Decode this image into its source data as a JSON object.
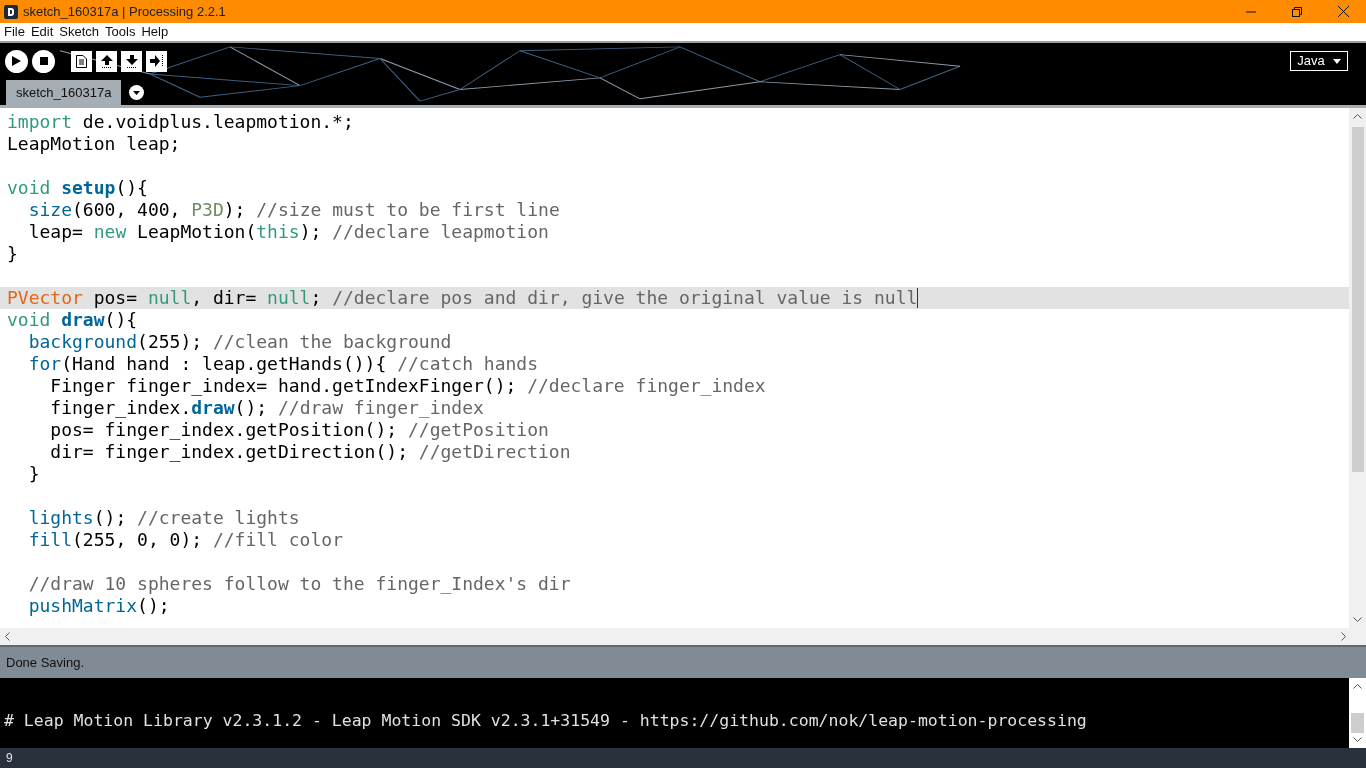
{
  "window": {
    "title": "sketch_160317a | Processing 2.2.1"
  },
  "menu": [
    "File",
    "Edit",
    "Sketch",
    "Tools",
    "Help"
  ],
  "toolbar": {
    "mode": "Java"
  },
  "tabs": [
    {
      "label": "sketch_160317a",
      "selected": true
    }
  ],
  "editor": {
    "lines": [
      {
        "selected": false,
        "tokens": [
          {
            "kind": "keyword",
            "text": "import"
          },
          {
            "kind": "plain",
            "text": " de.voidplus.leapmotion.*;"
          }
        ]
      },
      {
        "selected": false,
        "tokens": [
          {
            "kind": "plain",
            "text": "LeapMotion leap;"
          }
        ]
      },
      {
        "selected": false
      },
      {
        "selected": false,
        "tokens": [
          {
            "kind": "keyword",
            "text": "void "
          },
          {
            "kind": "method",
            "text": "setup"
          },
          {
            "kind": "plain",
            "text": "(){"
          }
        ]
      },
      {
        "selected": false,
        "tokens": [
          {
            "kind": "function",
            "text": "  size"
          },
          {
            "kind": "plain",
            "text": "(600, 400, "
          },
          {
            "kind": "constant",
            "text": "P3D"
          },
          {
            "kind": "plain",
            "text": "); "
          },
          {
            "kind": "comment",
            "text": "//size must to be first line"
          }
        ]
      },
      {
        "selected": false,
        "tokens": [
          {
            "kind": "plain",
            "text": "  leap= "
          },
          {
            "kind": "keyword",
            "text": "new"
          },
          {
            "kind": "plain",
            "text": " LeapMotion("
          },
          {
            "kind": "keyword",
            "text": "this"
          },
          {
            "kind": "plain",
            "text": "); "
          },
          {
            "kind": "comment",
            "text": "//declare leapmotion"
          }
        ]
      },
      {
        "selected": false,
        "tokens": [
          {
            "kind": "plain",
            "text": "}"
          }
        ]
      },
      {
        "selected": false
      },
      {
        "selected": true,
        "tokens": [
          {
            "kind": "type",
            "text": "PVector"
          },
          {
            "kind": "plain",
            "text": " pos= "
          },
          {
            "kind": "keyword",
            "text": "null"
          },
          {
            "kind": "plain",
            "text": ", dir= "
          },
          {
            "kind": "keyword",
            "text": "null"
          },
          {
            "kind": "plain",
            "text": "; "
          },
          {
            "kind": "comment",
            "text": "//declare pos and dir, give the original value is null"
          }
        ]
      },
      {
        "selected": false,
        "tokens": [
          {
            "kind": "keyword",
            "text": "void "
          },
          {
            "kind": "method",
            "text": "draw"
          },
          {
            "kind": "plain",
            "text": "(){"
          }
        ]
      },
      {
        "selected": false,
        "tokens": [
          {
            "kind": "function",
            "text": "  background"
          },
          {
            "kind": "plain",
            "text": "(255); "
          },
          {
            "kind": "comment",
            "text": "//clean the background"
          }
        ]
      },
      {
        "selected": false,
        "tokens": [
          {
            "kind": "function",
            "text": "  for"
          },
          {
            "kind": "plain",
            "text": "(Hand hand : leap.getHands()){ "
          },
          {
            "kind": "comment",
            "text": "//catch hands"
          }
        ]
      },
      {
        "selected": false,
        "tokens": [
          {
            "kind": "plain",
            "text": "    Finger finger_index= hand.getIndexFinger(); "
          },
          {
            "kind": "comment",
            "text": "//declare finger_index"
          }
        ]
      },
      {
        "selected": false,
        "tokens": [
          {
            "kind": "plain",
            "text": "    finger_index."
          },
          {
            "kind": "method",
            "text": "draw"
          },
          {
            "kind": "plain",
            "text": "(); "
          },
          {
            "kind": "comment",
            "text": "//draw finger_index"
          }
        ]
      },
      {
        "selected": false,
        "tokens": [
          {
            "kind": "plain",
            "text": "    pos= finger_index.getPosition(); "
          },
          {
            "kind": "comment",
            "text": "//getPosition"
          }
        ]
      },
      {
        "selected": false,
        "tokens": [
          {
            "kind": "plain",
            "text": "    dir= finger_index.getDirection(); "
          },
          {
            "kind": "comment",
            "text": "//getDirection"
          }
        ]
      },
      {
        "selected": false,
        "tokens": [
          {
            "kind": "plain",
            "text": "  }"
          }
        ]
      },
      {
        "selected": false
      },
      {
        "selected": false,
        "tokens": [
          {
            "kind": "function",
            "text": "  lights"
          },
          {
            "kind": "plain",
            "text": "(); "
          },
          {
            "kind": "comment",
            "text": "//create lights"
          }
        ]
      },
      {
        "selected": false,
        "tokens": [
          {
            "kind": "function",
            "text": "  fill"
          },
          {
            "kind": "plain",
            "text": "(255, 0, 0); "
          },
          {
            "kind": "comment",
            "text": "//fill color"
          }
        ]
      },
      {
        "selected": false
      },
      {
        "selected": false,
        "tokens": [
          {
            "kind": "comment",
            "text": "  //draw 10 spheres follow to the finger_Index's dir"
          }
        ]
      },
      {
        "selected": false,
        "tokens": [
          {
            "kind": "function",
            "text": "  pushMatrix"
          },
          {
            "kind": "plain",
            "text": "();"
          }
        ]
      }
    ]
  },
  "status": "Done Saving.",
  "console": [
    "# Leap Motion Library v2.3.1.2 - Leap Motion SDK v2.3.1+31549 - https://github.com/nok/leap-motion-processing"
  ],
  "line_number": "9"
}
